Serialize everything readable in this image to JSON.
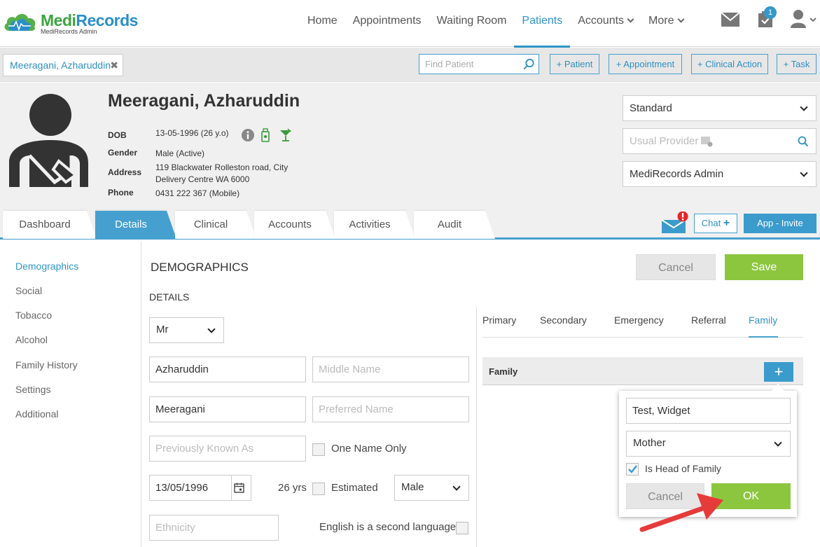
{
  "brand": {
    "name_a": "Medi",
    "name_b": "Records",
    "sub": "MediRecords Admin"
  },
  "nav": {
    "home": "Home",
    "appointments": "Appointments",
    "waiting_room": "Waiting Room",
    "patients": "Patients",
    "accounts": "Accounts",
    "more": "More",
    "task_badge": "1"
  },
  "subbar": {
    "patient_tab": "Meeragani, Azharuddin",
    "close": "✖",
    "find_placeholder": "Find Patient",
    "add_patient": "+ Patient",
    "add_appointment": "+ Appointment",
    "add_clinical_action": "+ Clinical Action",
    "add_task": "+ Task"
  },
  "patient": {
    "name": "Meeragani, Azharuddin",
    "dob_label": "DOB",
    "dob": "13-05-1996 (26 y.o)",
    "gender_label": "Gender",
    "gender": "Male (Active)",
    "address_label": "Address",
    "address_line1": "119 Blackwater Rolleston road, City",
    "address_line2": "Delivery Centre WA 6000",
    "phone_label": "Phone",
    "phone": "0431 222 367 (Mobile)"
  },
  "header_right": {
    "plan": "Standard",
    "usual_provider_placeholder": "Usual Provider",
    "practice": "MediRecords Admin"
  },
  "tabs": {
    "dashboard": "Dashboard",
    "details": "Details",
    "clinical": "Clinical",
    "accounts": "Accounts",
    "activities": "Activities",
    "audit": "Audit",
    "chat": "Chat",
    "app_invite": "App - Invite"
  },
  "sidebar": {
    "items": [
      "Demographics",
      "Social",
      "Tobacco",
      "Alcohol",
      "Family History",
      "Settings",
      "Additional"
    ]
  },
  "form": {
    "section_title": "DEMOGRAPHICS",
    "details_title": "DETAILS",
    "cancel": "Cancel",
    "save": "Save",
    "title_value": "Mr",
    "first_name": "Azharuddin",
    "middle_name_placeholder": "Middle Name",
    "last_name": "Meeragani",
    "preferred_name_placeholder": "Preferred Name",
    "previously_known_placeholder": "Previously Known As",
    "one_name_only": "One Name Only",
    "dob_value": "13/05/1996",
    "age": "26 yrs",
    "estimated": "Estimated",
    "sex_value": "Male",
    "ethnicity_placeholder": "Ethnicity",
    "second_language": "English is a second language"
  },
  "contacts": {
    "tabs": [
      "Primary",
      "Secondary",
      "Emergency",
      "Referral",
      "Family"
    ],
    "family_header": "Family",
    "plus": "+"
  },
  "popover": {
    "name": "Test, Widget",
    "relationship": "Mother",
    "head_of_family": "Is Head of Family",
    "cancel": "Cancel",
    "ok": "OK"
  },
  "colors": {
    "primary": "#3a9bcc",
    "success": "#8cc63f",
    "alert": "#e8232a",
    "arrow": "#e63b3b"
  }
}
